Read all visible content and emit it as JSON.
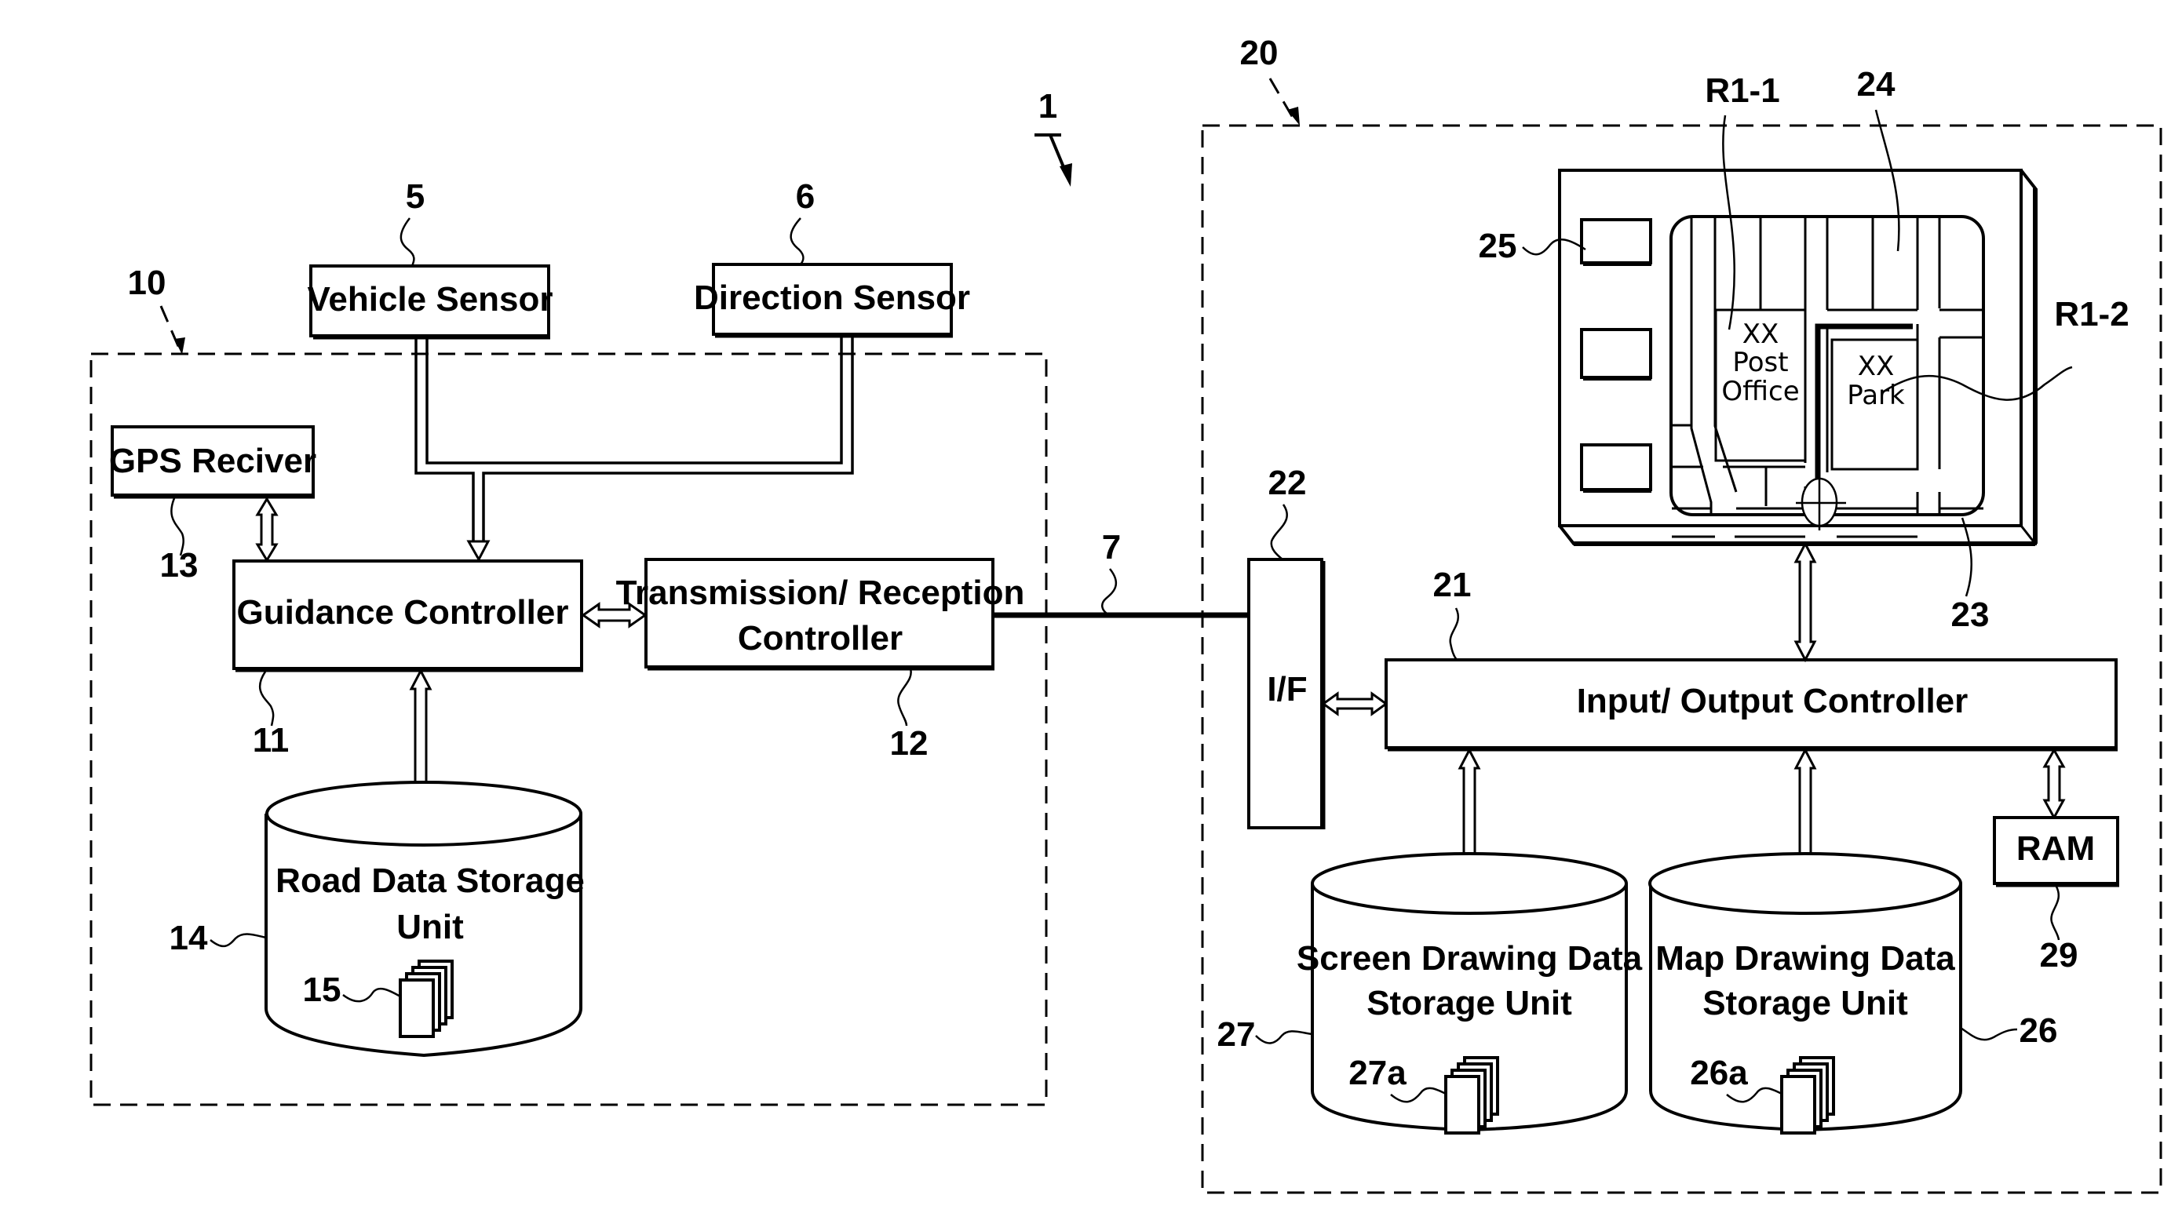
{
  "figure": {
    "system_ref": "1",
    "vehicle_unit": {
      "ref": "10",
      "components": {
        "vehicle_sensor": {
          "label": "Vehicle Sensor",
          "ref": "5"
        },
        "direction_sensor": {
          "label": "Direction Sensor",
          "ref": "6"
        },
        "gps_receiver": {
          "label": "GPS Reciver",
          "ref": "13"
        },
        "guidance_controller": {
          "label": "Guidance Controller",
          "ref": "11"
        },
        "transmission_controller": {
          "label_line1": "Transmission/ Reception",
          "label_line2": "Controller",
          "ref": "12"
        },
        "road_data_storage": {
          "label_line1": "Road Data Storage",
          "label_line2": "Unit",
          "ref": "14",
          "data_ref": "15"
        }
      }
    },
    "link": {
      "ref": "7"
    },
    "terminal_unit": {
      "ref": "20",
      "components": {
        "interface": {
          "label": "I/F",
          "ref": "22"
        },
        "io_controller": {
          "label": "Input/ Output Controller",
          "ref": "21"
        },
        "display": {
          "ref": "23"
        },
        "map_area": {
          "ref": "24"
        },
        "buttons": {
          "ref": "25"
        },
        "region_1": {
          "ref": "R1-1",
          "line1": "XX",
          "line2": "Post",
          "line3": "Office"
        },
        "region_2": {
          "ref": "R1-2",
          "line1": "XX",
          "line2": "Park"
        },
        "screen_storage": {
          "label_line1": "Screen Drawing Data",
          "label_line2": "Storage Unit",
          "ref": "27",
          "data_ref": "27a"
        },
        "map_storage": {
          "label_line1": "Map Drawing Data",
          "label_line2": "Storage Unit",
          "ref": "26",
          "data_ref": "26a"
        },
        "ram": {
          "label": "RAM",
          "ref": "29"
        }
      }
    }
  }
}
